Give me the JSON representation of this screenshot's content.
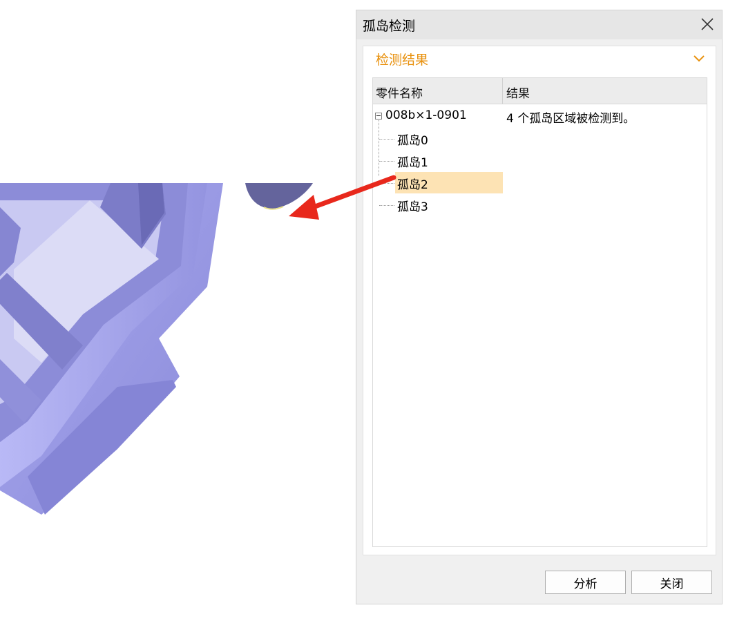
{
  "dialog": {
    "title": "孤岛检测",
    "close_icon": "close-icon",
    "section_title": "检测结果",
    "collapse_icon": "chevron-down-icon",
    "columns": [
      "零件名称",
      "结果"
    ],
    "root": {
      "name": "008b×1-0901",
      "result": "4 个孤岛区域被检测到。"
    },
    "children": [
      {
        "name": "孤岛0"
      },
      {
        "name": "孤岛1"
      },
      {
        "name": "孤岛2",
        "selected": true
      },
      {
        "name": "孤岛3"
      }
    ],
    "buttons": {
      "analyze": "分析",
      "close": "关闭"
    }
  },
  "colors": {
    "accent": "#e8900c",
    "selection": "#fde3b4",
    "model": "#9b9be8",
    "arrow": "#e8281c"
  }
}
